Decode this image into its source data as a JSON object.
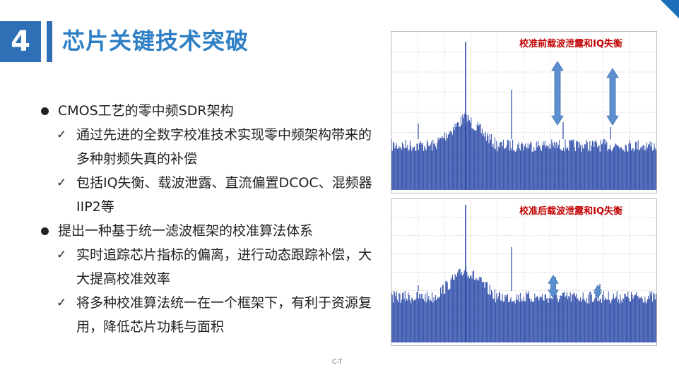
{
  "slide": {
    "number": "4",
    "title": "芯片关键技术突破",
    "footer": "C-T"
  },
  "bullets": [
    {
      "text": "CMOS工艺的零中频SDR架构",
      "subs": [
        {
          "text": "通过先进的全数字校准技术实现零中频架构带来的多种射频失真的补偿"
        },
        {
          "text": "包括IQ失衡、载波泄露、直流偏置DCOC、混频器IIP2等"
        }
      ]
    },
    {
      "text": "提出一种基于统一滤波框架的校准算法体系",
      "subs": [
        {
          "text": "实时追踪芯片指标的偏离，进行动态跟踪补偿，大大提高校准效率"
        },
        {
          "text": "将多种校准算法统一在一个框架下，有利于资源复用，降低芯片功耗与面积"
        }
      ]
    }
  ],
  "charts": {
    "top": {
      "caption": "校准前载波泄露和IQ失衡"
    },
    "bottom": {
      "caption": "校准后载波泄露和IQ失衡"
    }
  },
  "colors": {
    "accent": "#2e6fb5",
    "title": "#2e7fc4",
    "caption": "#c00000",
    "spectrum": "#2b4aa8",
    "arrow": "#5b8fcf"
  }
}
